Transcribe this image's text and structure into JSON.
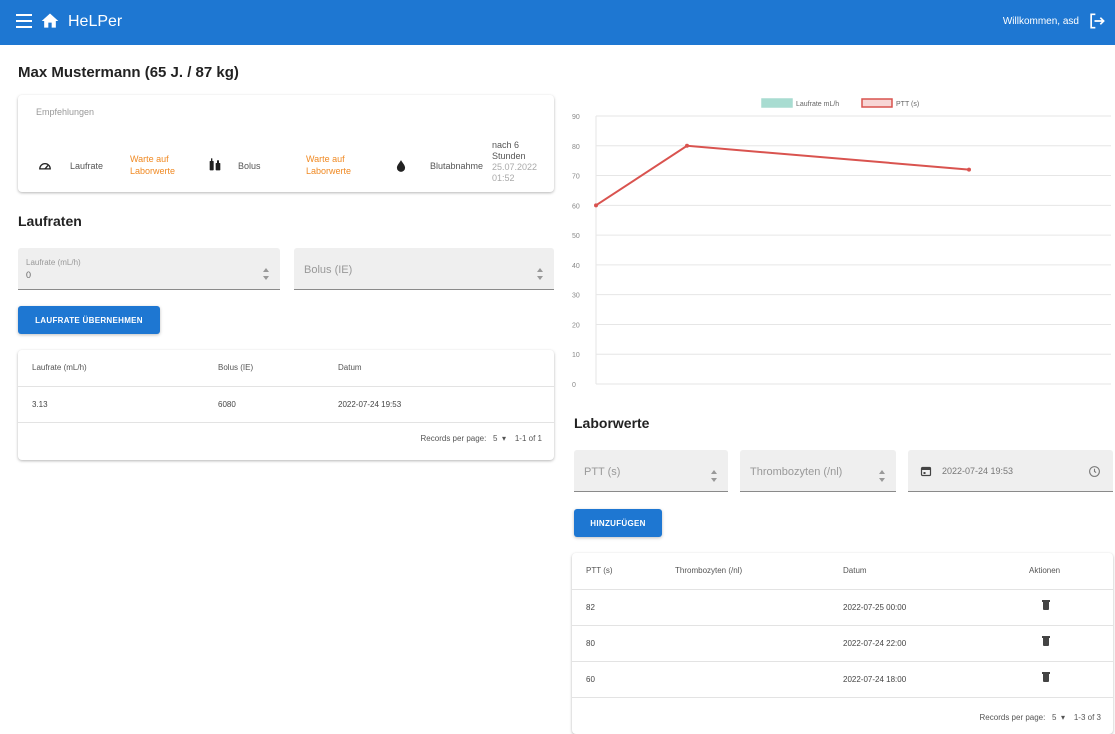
{
  "app": {
    "title": "HeLPer",
    "welcome": "Willkommen, asd"
  },
  "patient": {
    "header": "Max Mustermann (65 J. / 87 kg)"
  },
  "empfehlungen": {
    "title": "Empfehlungen",
    "laufrate_label": "Laufrate",
    "laufrate_value": "Warte auf Laborwerte",
    "bolus_label": "Bolus",
    "bolus_value": "Warte auf Laborwerte",
    "blut_label": "Blutabnahme",
    "blut_line1": "nach 6",
    "blut_line2": "Stunden",
    "blut_line3": "25.07.2022",
    "blut_line4": "01:52"
  },
  "laufraten": {
    "title": "Laufraten",
    "laufrate_field_label": "Laufrate (mL/h)",
    "laufrate_field_value": "0",
    "bolus_field_placeholder": "Bolus (IE)",
    "button": "LAUFRATE ÜBERNEHMEN",
    "columns": [
      "Laufrate (mL/h)",
      "Bolus (IE)",
      "Datum"
    ],
    "rows": [
      [
        "3.13",
        "6080",
        "2022-07-24 19:53"
      ]
    ],
    "pagination": {
      "rpp_label": "Records per page:",
      "rpp_value": "5",
      "range": "1-1 of 1"
    }
  },
  "chart_data": {
    "type": "line",
    "series": [
      {
        "name": "Laufrate mL/h",
        "color": "#a8dcd1",
        "values": []
      },
      {
        "name": "PTT (s)",
        "color": "#d9534f",
        "x_index": [
          0,
          1,
          2
        ],
        "values": [
          60,
          80,
          72
        ]
      }
    ],
    "ylim": [
      0,
      90
    ],
    "yticks": [
      0,
      10,
      20,
      30,
      40,
      50,
      60,
      70,
      80,
      90
    ],
    "grid": true,
    "legend": "top-center"
  },
  "laborwerte": {
    "title": "Laborwerte",
    "ptt_placeholder": "PTT (s)",
    "thrombo_placeholder": "Thrombozyten (/nl)",
    "date_value": "2022-07-24 19:53",
    "button": "HINZUFÜGEN",
    "columns": [
      "PTT (s)",
      "Thrombozyten (/nl)",
      "Datum",
      "Aktionen"
    ],
    "rows": [
      [
        "82",
        "",
        "2022-07-25 00:00"
      ],
      [
        "80",
        "",
        "2022-07-24 22:00"
      ],
      [
        "60",
        "",
        "2022-07-24 18:00"
      ]
    ],
    "pagination": {
      "rpp_label": "Records per page:",
      "rpp_value": "5",
      "range": "1-3 of 3"
    }
  }
}
